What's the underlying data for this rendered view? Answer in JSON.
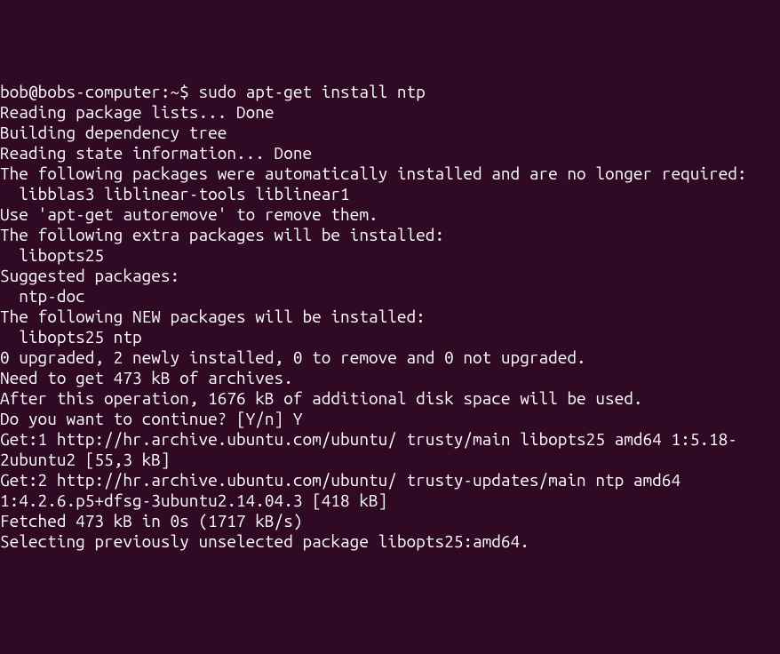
{
  "terminal": {
    "prompt": "bob@bobs-computer:~$ ",
    "command": "sudo apt-get install ntp",
    "lines": [
      "Reading package lists... Done",
      "Building dependency tree",
      "Reading state information... Done",
      "The following packages were automatically installed and are no longer required:",
      "  libblas3 liblinear-tools liblinear1",
      "Use 'apt-get autoremove' to remove them.",
      "The following extra packages will be installed:",
      "  libopts25",
      "Suggested packages:",
      "  ntp-doc",
      "The following NEW packages will be installed:",
      "  libopts25 ntp",
      "0 upgraded, 2 newly installed, 0 to remove and 0 not upgraded.",
      "Need to get 473 kB of archives.",
      "After this operation, 1676 kB of additional disk space will be used.",
      "Do you want to continue? [Y/n] Y",
      "Get:1 http://hr.archive.ubuntu.com/ubuntu/ trusty/main libopts25 amd64 1:5.18-2ubuntu2 [55,3 kB]",
      "Get:2 http://hr.archive.ubuntu.com/ubuntu/ trusty-updates/main ntp amd64 1:4.2.6.p5+dfsg-3ubuntu2.14.04.3 [418 kB]",
      "Fetched 473 kB in 0s (1717 kB/s)",
      "Selecting previously unselected package libopts25:amd64."
    ]
  }
}
